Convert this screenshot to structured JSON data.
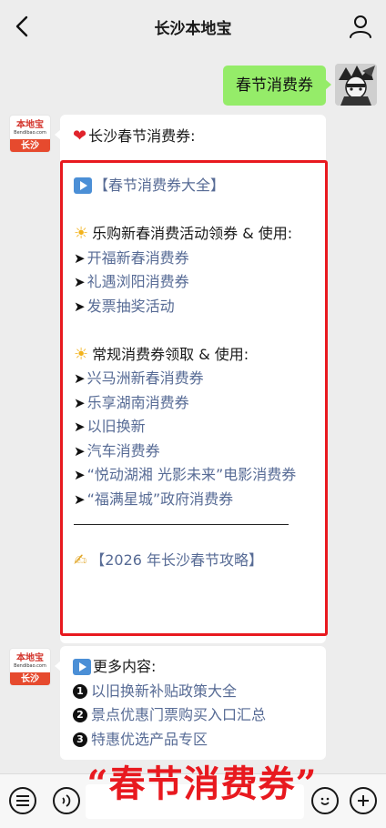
{
  "header": {
    "title": "长沙本地宝"
  },
  "outgoing": {
    "text": "春节消费券"
  },
  "bot": {
    "logo": "本地宝",
    "site": "Bendibao.com",
    "city": "长沙"
  },
  "bubble1": {
    "title": "长沙春节消费券:",
    "heading_link": "【春节消费券大全】",
    "section1_title": "乐购新春消费活动领券 & 使用:",
    "section1_links": [
      "开福新春消费券",
      "礼遇浏阳消费券",
      "发票抽奖活动"
    ],
    "section2_title": "常规消费券领取 & 使用:",
    "section2_links": [
      "兴马洲新春消费券",
      "乐享湖南消费券",
      "以旧换新",
      "汽车消费券",
      "“悦动湖湘 光影未来”电影消费券",
      "“福满星城”政府消费券"
    ],
    "footer_link": "【2026 年长沙春节攻略】"
  },
  "bubble2": {
    "title": "更多内容:",
    "items": [
      {
        "num": "1",
        "text": "以旧换新补贴政策大全"
      },
      {
        "num": "2",
        "text": "景点优惠门票购买入口汇总"
      },
      {
        "num": "3",
        "text": "特惠优选产品专区"
      }
    ]
  },
  "overlay": {
    "text": "“春节消费券”"
  },
  "colors": {
    "bubble_green": "#95ec69",
    "link_blue": "#576b95",
    "frame_red": "#e8191f",
    "overlay_red": "#e8191f"
  },
  "icons": [
    "back-arrow-icon",
    "profile-icon",
    "heart-icon",
    "play-icon",
    "sun-icon",
    "arrow-icon",
    "writing-hand-icon",
    "menu-icon",
    "voice-icon",
    "emoji-icon",
    "plus-icon"
  ]
}
